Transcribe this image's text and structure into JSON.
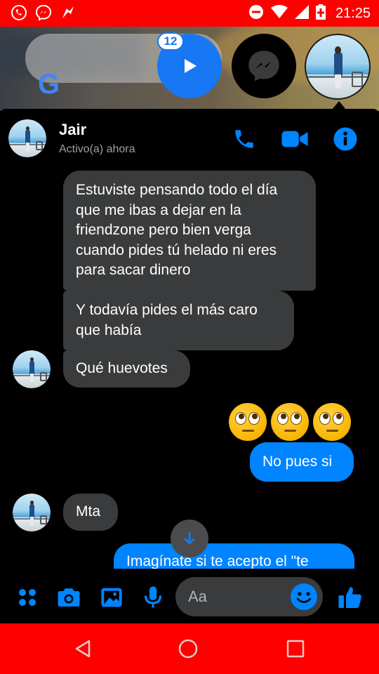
{
  "status_bar": {
    "time": "21:25",
    "left_icons": [
      "whatsapp-icon",
      "messenger-icon",
      "notification-icon"
    ],
    "right_icons": [
      "do-not-disturb-icon",
      "wifi-icon",
      "signal-icon",
      "battery-icon"
    ],
    "background": "#ff0000"
  },
  "home": {
    "search_logo": "G",
    "chat_heads": {
      "video_badge": "12"
    }
  },
  "chat": {
    "contact_name": "Jair",
    "contact_status": "Activo(a) ahora",
    "header_icons": [
      "phone-icon",
      "video-call-icon",
      "info-icon"
    ],
    "messages": {
      "m1": "Estuviste pensando todo el día que me ibas a dejar en la friendzone pero bien verga cuando pides tú helado ni eres para sacar dinero",
      "m2": "Y todavía pides el más caro que había",
      "m3": "Qué huevotes",
      "m4": "🙄🙄🙄",
      "m5": "No pues si",
      "m6": "Mta",
      "m7": "Imagínate si te acepto el \"te"
    },
    "accent": "#0084ff",
    "incoming_bubble": "#3a3b3c"
  },
  "composer": {
    "placeholder": "Aa",
    "icons": [
      "menu-dots-icon",
      "camera-icon",
      "gallery-icon",
      "microphone-icon",
      "emoji-icon",
      "like-icon"
    ]
  },
  "nav_bar": {
    "icons": [
      "back-icon",
      "home-icon",
      "recents-icon"
    ]
  }
}
